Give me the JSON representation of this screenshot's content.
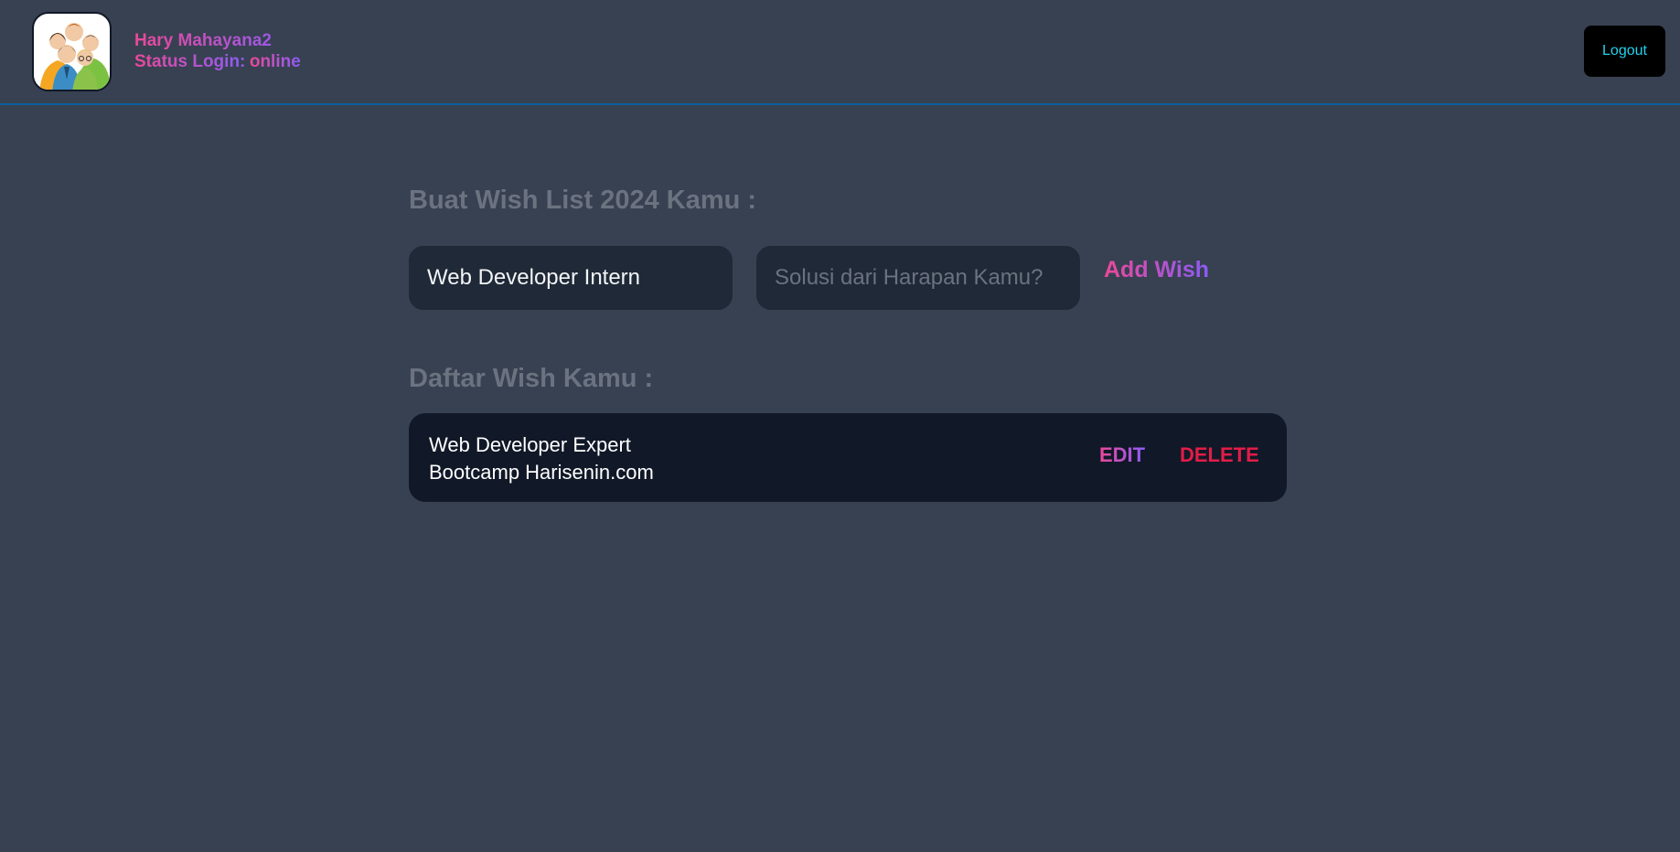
{
  "header": {
    "avatar_icon": "team-people-icon",
    "user_name": "Hary Mahayana2",
    "status_label": "Status Login:",
    "status_value": "online",
    "logout_label": "Logout"
  },
  "form": {
    "title": "Buat Wish List 2024 Kamu :",
    "wish_value": "Web Developer Intern",
    "solution_placeholder": "Solusi dari Harapan Kamu?",
    "add_label": "Add Wish"
  },
  "list": {
    "title": "Daftar Wish Kamu :",
    "items": [
      {
        "wish": "Web Developer Expert",
        "solution": "Bootcamp Harisenin.com",
        "edit_label": "EDIT",
        "delete_label": "DELETE"
      }
    ]
  },
  "colors": {
    "background": "#374151",
    "card": "#111827",
    "input": "#1f2937",
    "gradient_start": "#ec4899",
    "gradient_end": "#8b5cf6",
    "delete": "#e11d48",
    "logout_text": "#22d3ee",
    "header_border": "#0c5f9e"
  }
}
